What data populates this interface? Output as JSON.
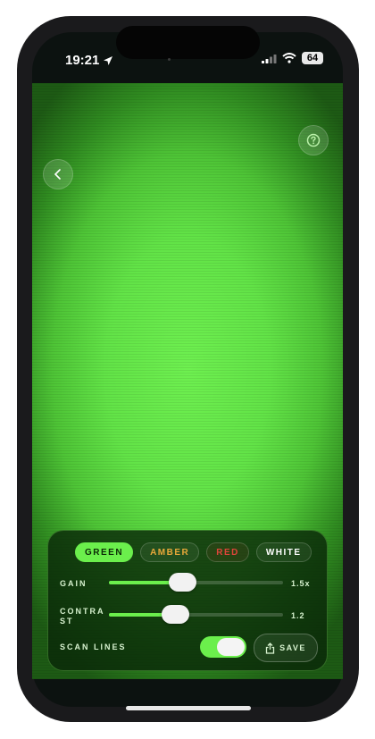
{
  "status_bar": {
    "time": "19:21",
    "battery": "64",
    "icons": [
      "location-arrow-icon",
      "cellular-signal-icon",
      "wifi-icon",
      "battery-icon"
    ]
  },
  "header": {
    "back_icon": "chevron-left-icon",
    "help_icon": "question-circle-icon"
  },
  "colors": {
    "accent": "#6bef4c",
    "amber": "#e9a83a",
    "red": "#e0453a",
    "white": "#ffffff",
    "panel_bg": "#0a2808"
  },
  "color_modes": [
    {
      "label": "GREEN",
      "color": "#0b2a06",
      "active": true
    },
    {
      "label": "AMBER",
      "color": "#e9a83a",
      "active": false
    },
    {
      "label": "RED",
      "color": "#e0453a",
      "active": false
    },
    {
      "label": "WHITE",
      "color": "#ffffff",
      "active": false
    }
  ],
  "controls": {
    "gain": {
      "label": "GAIN",
      "value_text": "1.5x",
      "level": 0.42
    },
    "contrast": {
      "label": "CONTRA\nST",
      "value_text": "1.2",
      "level": 0.38
    },
    "scan_lines": {
      "label": "SCAN LINES",
      "enabled": true
    }
  },
  "save": {
    "label": "SAVE",
    "icon": "share-icon"
  }
}
